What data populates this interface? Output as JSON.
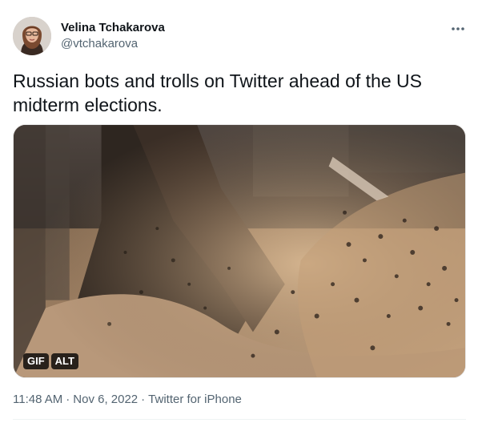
{
  "author": {
    "name": "Velina Tchakarova",
    "handle": "@vtchakarova"
  },
  "tweet": {
    "text": "Russian bots and trolls on Twitter ahead of the US midterm elections."
  },
  "media": {
    "badge_gif": "GIF",
    "badge_alt": "ALT"
  },
  "meta": {
    "time": "11:48 AM",
    "separator": "·",
    "date": "Nov 6, 2022",
    "source": "Twitter for iPhone"
  },
  "icons": {
    "more": "more-dots-icon"
  },
  "colors": {
    "text_primary": "#0f1419",
    "text_secondary": "#536471"
  }
}
